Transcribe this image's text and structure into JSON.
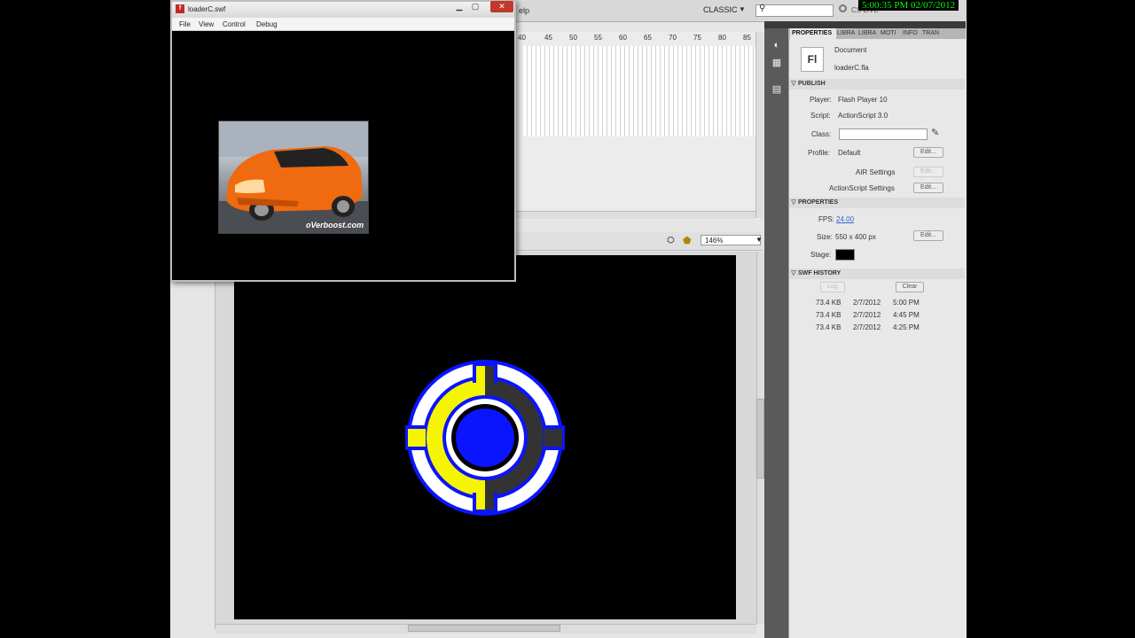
{
  "swf_window": {
    "title": "loaderC.swf",
    "menu": [
      "File",
      "View",
      "Control",
      "Debug"
    ],
    "photo_caption": "oVerboost.com"
  },
  "topbar": {
    "menu_help": "elp",
    "workspace": "CLASSIC",
    "cs_live": "CS LIVE",
    "clock": "5:00:35 PM 02/07/2012"
  },
  "timeline": {
    "ruler": [
      "40",
      "45",
      "50",
      "55",
      "60",
      "65",
      "70",
      "75",
      "80",
      "85"
    ]
  },
  "stage_toolbar": {
    "zoom": "146%"
  },
  "properties_panel": {
    "tabs": [
      "PROPERTIES",
      "LIBRA",
      "LIBRA",
      "MOTI",
      "INFO",
      "TRAN"
    ],
    "doc_type": "Document",
    "doc_name": "loaderC.fla",
    "fl_icon": "Fl",
    "publish": {
      "header": "PUBLISH",
      "player_label": "Player:",
      "player_value": "Flash Player 10",
      "script_label": "Script:",
      "script_value": "ActionScript 3.0",
      "class_label": "Class:",
      "profile_label": "Profile:",
      "profile_value": "Default",
      "edit": "Edit...",
      "air_settings": "AIR Settings",
      "as_settings": "ActionScript Settings"
    },
    "properties": {
      "header": "PROPERTIES",
      "fps_label": "FPS:",
      "fps_value": "24.00",
      "size_label": "Size:",
      "size_value": "550 x 400 px",
      "stage_label": "Stage:",
      "stage_color": "#000000"
    },
    "swf_history": {
      "header": "SWF HISTORY",
      "log": "Log",
      "clear": "Clear",
      "rows": [
        {
          "size": "73.4 KB",
          "date": "2/7/2012",
          "time": "5:00 PM"
        },
        {
          "size": "73.4 KB",
          "date": "2/7/2012",
          "time": "4:45 PM"
        },
        {
          "size": "73.4 KB",
          "date": "2/7/2012",
          "time": "4:25 PM"
        }
      ]
    }
  },
  "colors": {
    "logo_blue": "#0a14ff",
    "logo_yellow": "#f5f500",
    "logo_gray": "#333333",
    "car_orange": "#f06a10"
  },
  "icons": [
    "pencil-icon",
    "search-icon",
    "edit-symbol-icon",
    "edit-scene-icon",
    "close-icon",
    "minimize-icon",
    "maximize-icon"
  ]
}
